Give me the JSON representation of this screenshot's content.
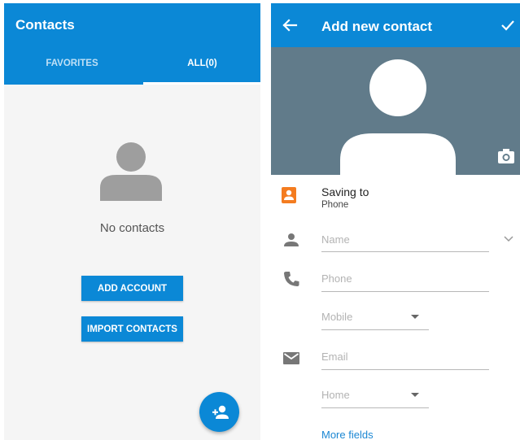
{
  "contacts_screen": {
    "title": "Contacts",
    "tabs": [
      {
        "label": "FAVORITES",
        "selected": false
      },
      {
        "label": "ALL(0)",
        "selected": true
      }
    ],
    "empty_message": "No contacts",
    "add_account_label": "ADD ACCOUNT",
    "import_contacts_label": "IMPORT CONTACTS",
    "fab_icon": "add-person-icon"
  },
  "add_contact_screen": {
    "title": "Add new contact",
    "back_icon": "arrow-back-icon",
    "save_icon": "check-icon",
    "camera_icon": "camera-icon",
    "saving_to_label": "Saving to",
    "saving_to_value": "Phone",
    "name_placeholder": "Name",
    "phone_placeholder": "Phone",
    "phone_type": "Mobile",
    "email_placeholder": "Email",
    "email_type": "Home",
    "more_fields_label": "More fields"
  },
  "colors": {
    "primary": "#0b88d6",
    "photo_bg": "#617b8a",
    "saving_icon": "#f47c20",
    "link": "#1b87d3"
  }
}
